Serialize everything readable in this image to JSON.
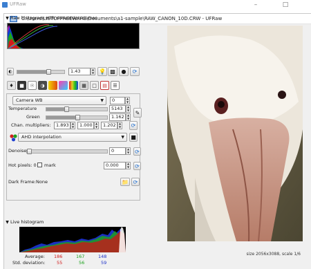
{
  "outer_window": {
    "title": "UFRaw"
  },
  "window": {
    "title": "C:\\Users\\LISTOFFREEWARE\\Documents\\a1-sample\\RAW_CANON_10D.CRW - UFRaw"
  },
  "raw_histogram": {
    "label": "Raw histogram with conversion curves"
  },
  "exposure": {
    "value": "1.43"
  },
  "white_balance": {
    "preset": "Camera WB",
    "fine_tune": "0",
    "temperature_label": "Temperature",
    "temperature": "5143",
    "green_label": "Green",
    "green": "1.162",
    "chan_label": "Chan. multipliers:",
    "chan": [
      "1.893",
      "1.000",
      "1.202"
    ]
  },
  "interpolation": {
    "value": "AHD interpolation"
  },
  "denoise": {
    "label": "Denoise:",
    "value": "0"
  },
  "hot_pixels": {
    "label": "Hot pixels: 0",
    "mark_label": "mark",
    "value": "0.000"
  },
  "dark_frame": {
    "label": "Dark Frame:",
    "value": "None"
  },
  "live_histogram": {
    "label": "Live histogram",
    "average_label": "Average:",
    "average": [
      "186",
      "167",
      "148"
    ],
    "std_label": "Std. deviation:",
    "std": [
      "55",
      "56",
      "59"
    ]
  },
  "colors": {
    "red": "#d01818",
    "green": "#18a018",
    "blue": "#1c30c8"
  },
  "status": {
    "text": "size 2056x3088, scale 1/6"
  }
}
